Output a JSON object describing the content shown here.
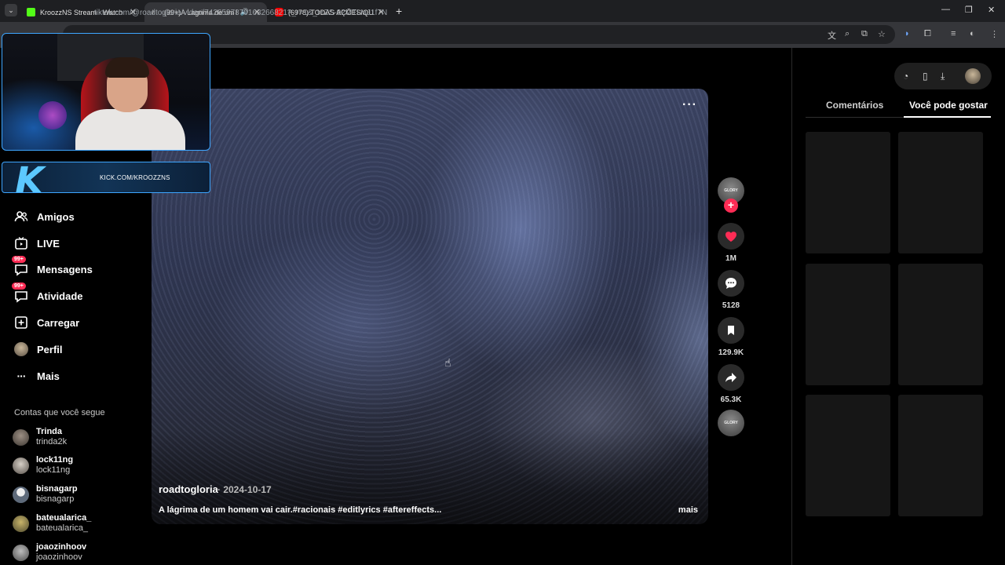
{
  "browser": {
    "tabs": [
      {
        "title": "KroozzNS Stream - Watch Live",
        "favicon": "kick-icon",
        "color": "#53fc18"
      },
      {
        "title": "(99+)A Lagrima de um Hom",
        "favicon": "tiktok-icon",
        "color": "#ffffff"
      },
      {
        "title": "(6978) TODAS AÇÕES/QUEBRA",
        "favicon": "youtube-icon",
        "color": "#ff0000"
      }
    ],
    "url": "tiktok.com/@roadtogloria/video/7426597870163266821?_r=1&_t=ZS-92MTUaJ1f7N"
  },
  "sidebar": {
    "items": [
      {
        "label": "Amigos",
        "icon": "friends-icon"
      },
      {
        "label": "LIVE",
        "icon": "live-icon"
      },
      {
        "label": "Mensagens",
        "icon": "messages-icon",
        "badge": "99+"
      },
      {
        "label": "Atividade",
        "icon": "activity-icon",
        "badge": "99+"
      },
      {
        "label": "Carregar",
        "icon": "upload-icon"
      },
      {
        "label": "Perfil",
        "icon": "profile-avatar"
      },
      {
        "label": "Mais",
        "icon": "more-icon"
      }
    ],
    "following_title": "Contas que você segue",
    "following": [
      {
        "name": "Trinda",
        "handle": "trinda2k"
      },
      {
        "name": "lock11ng",
        "handle": "lock11ng"
      },
      {
        "name": "bisnagarp",
        "handle": "bisnagarp"
      },
      {
        "name": "bateualarica_",
        "handle": "bateualarica_"
      },
      {
        "name": "joaozinhoov",
        "handle": "joaozinhoov"
      }
    ]
  },
  "video": {
    "author": "roadtogloria",
    "date": "· 2024-10-17",
    "description": "A lágrima de um homem vai cair.#racionais #editlyrics #aftereffects...",
    "more_label": "mais",
    "options": "···"
  },
  "actions": {
    "likes": "1M",
    "comments": "5128",
    "saves": "129.9K",
    "shares": "65.3K",
    "avatar_text": "GLORY"
  },
  "right_panel": {
    "tabs": [
      "Comentários",
      "Você pode gostar"
    ],
    "active_tab": 1
  },
  "overlay": {
    "kick_url": "KICK.COM/KROOZZNS",
    "logo_letter": "K"
  },
  "colors": {
    "accent": "#fe2c55",
    "overlay_border": "#3ea6ff"
  }
}
